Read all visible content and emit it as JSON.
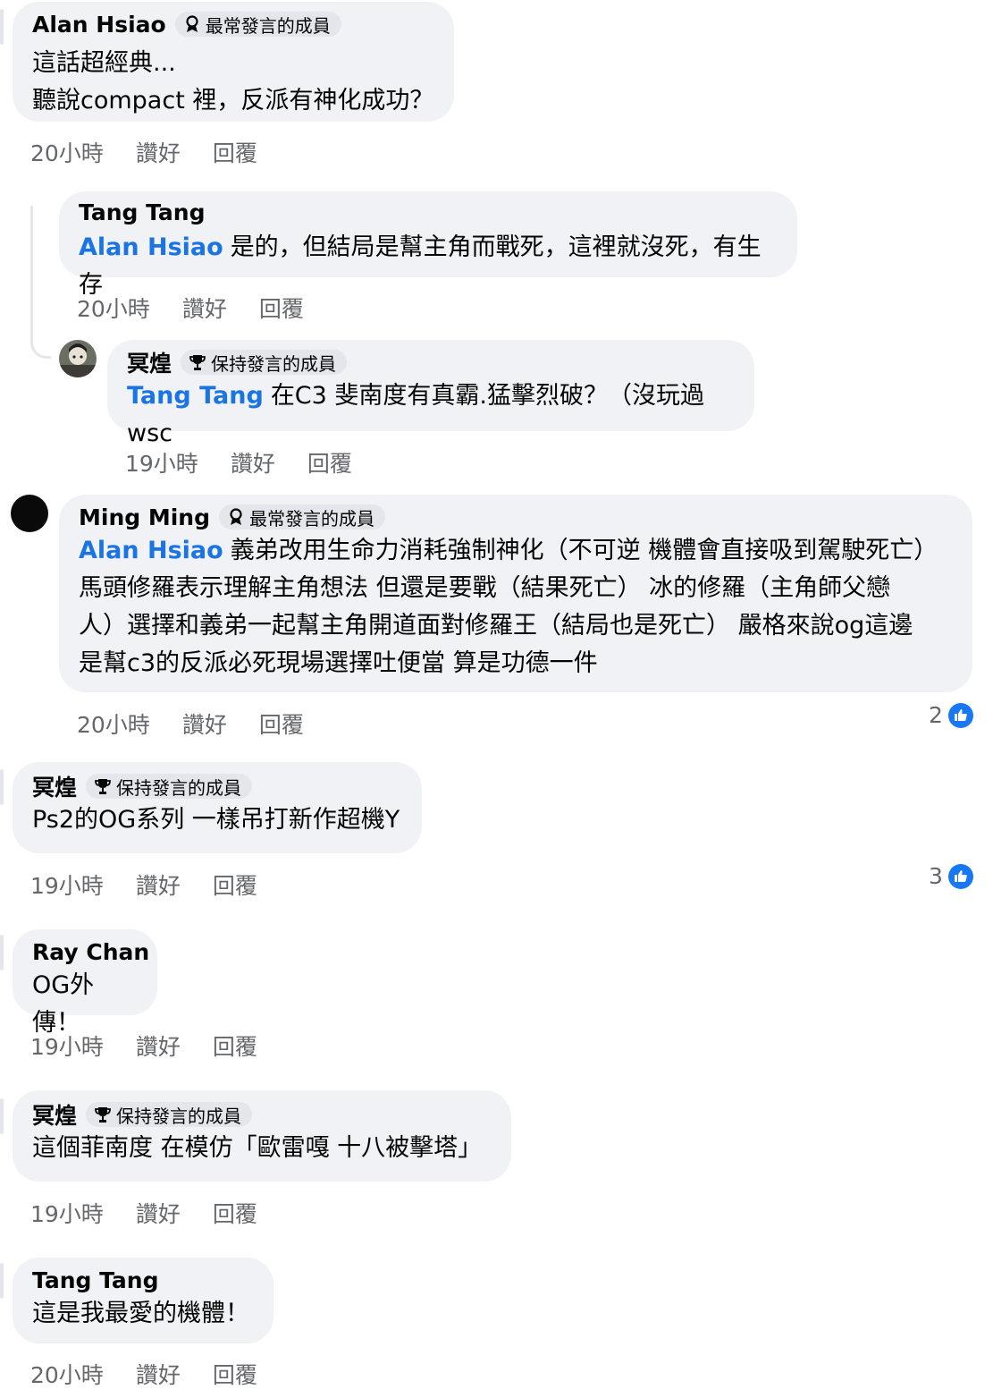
{
  "comments": [
    {
      "name": "Alan Hsiao",
      "badge": "最常發言的成員",
      "lines": [
        "這話超經典...",
        "聽說compact 裡，反派有神化成功？"
      ],
      "time": "20小時",
      "like": "讚好",
      "reply": "回覆"
    },
    {
      "name": "Tang Tang",
      "mention": "Alan Hsiao",
      "lines": [
        "是的，但結局是幫主角而戰死，這裡就沒死，有生存"
      ],
      "time": "20小時",
      "like": "讚好",
      "reply": "回覆"
    },
    {
      "name": "冥煌",
      "badge": "保持發言的成員",
      "mention": "Tang Tang",
      "lines": [
        "在C3 斐南度有真霸.猛擊烈破？（沒玩過wsc"
      ],
      "time": "19小時",
      "like": "讚好",
      "reply": "回覆"
    },
    {
      "name": "Ming Ming",
      "badge": "最常發言的成員",
      "mention": "Alan Hsiao",
      "lines": [
        "義弟改用生命力消耗強制神化（不可逆 機體會直接吸到駕駛死亡）",
        "馬頭修羅表示理解主角想法 但還是要戰（結果死亡） 冰的修羅（主角師父戀",
        "人）選擇和義弟一起幫主角開道面對修羅王（結局也是死亡） 嚴格來說og這邊",
        "是幫c3的反派必死現場選擇吐便當 算是功德一件"
      ],
      "time": "20小時",
      "like": "讚好",
      "reply": "回覆",
      "reactions": "2"
    },
    {
      "name": "冥煌",
      "badge": "保持發言的成員",
      "lines": [
        "Ps2的OG系列 一樣吊打新作超機Y"
      ],
      "time": "19小時",
      "like": "讚好",
      "reply": "回覆",
      "reactions": "3"
    },
    {
      "name": "Ray Chan",
      "lines": [
        "OG外傳！"
      ],
      "time": "19小時",
      "like": "讚好",
      "reply": "回覆"
    },
    {
      "name": "冥煌",
      "badge": "保持發言的成員",
      "lines": [
        "這個菲南度 在模仿「歐雷嘎 十八被擊塔」"
      ],
      "time": "19小時",
      "like": "讚好",
      "reply": "回覆"
    },
    {
      "name": "Tang Tang",
      "lines": [
        "這是我最愛的機體！"
      ],
      "time": "20小時",
      "like": "讚好",
      "reply": "回覆"
    }
  ],
  "colors": {
    "bubble": "#f0f2f5",
    "mention": "#1b74e4",
    "meta": "#65676b",
    "like_blue": "#1877f2"
  },
  "icons": {
    "top_member_badge": "trophy-ribbon-icon",
    "steady_member_badge": "trophy-icon",
    "reaction": "thumbs-up-icon"
  }
}
